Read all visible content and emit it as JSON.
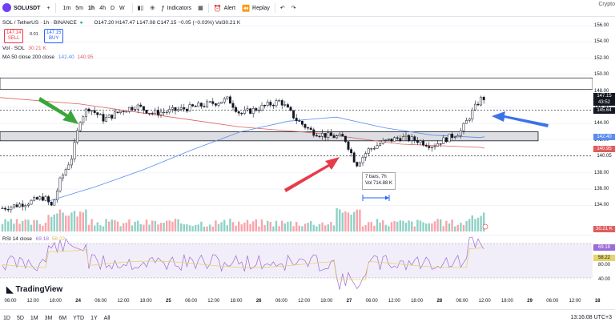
{
  "topbar": {
    "symbol": "SOLUSDT",
    "timeframes": [
      "1m",
      "5m",
      "1h",
      "4h",
      "D",
      "W"
    ],
    "active_timeframe": "1h",
    "indicators_label": "Indicators",
    "alert_label": "Alert",
    "replay_label": "Replay",
    "crypto_label": "Crypto"
  },
  "legend": {
    "title": "SOL / TetherUS · 1h · BINANCE",
    "ohlc": "O147.20 H147.47 L147.08 C147.15 −0.05 (−0.03%) Vol30.21 K",
    "sell_price": "147.14",
    "sell_label": "SELL",
    "spread": "0.01",
    "buy_price": "147.15",
    "buy_label": "BUY",
    "vol_label": "Vol · SOL",
    "vol_value": "30.21 K",
    "ma_label": "MA 50 close 200 close",
    "ma50": "142.40",
    "ma200": "140.95",
    "rsi_label": "RSI 14 close",
    "rsi_value": "69.18",
    "rsi_ma": "58.22"
  },
  "price_axis": {
    "ticks": [
      "156.00",
      "154.00",
      "152.00",
      "150.00",
      "148.00",
      "146.00",
      "144.00",
      "142.00",
      "140.00",
      "138.00",
      "136.00",
      "134.00"
    ],
    "current_price": "147.15",
    "countdown": "43:52",
    "level_1": "145.64",
    "ma50_tag": "142.40",
    "ma200_tag": "140.95",
    "level_2": "140.05",
    "volume_tag": "30.21 K"
  },
  "rsi_axis": {
    "ticks": [
      "80.00",
      "40.00"
    ],
    "rsi_tag": "69.18",
    "rsi_ma_tag": "58.22"
  },
  "time_axis": {
    "ticks": [
      "06:00",
      "12:00",
      "18:00",
      "24",
      "06:00",
      "12:00",
      "18:00",
      "25",
      "06:00",
      "12:00",
      "18:00",
      "26",
      "06:00",
      "12:00",
      "18:00",
      "27",
      "06:00",
      "12:00",
      "18:00",
      "28",
      "06:00",
      "12:00",
      "18:00",
      "29",
      "06:00",
      "12:00",
      "18"
    ]
  },
  "annotation": {
    "bars": "7 bars, 7h",
    "vol": "Vol 714.88 K"
  },
  "bottombar": {
    "ranges": [
      "1D",
      "5D",
      "1M",
      "3M",
      "6M",
      "YTD",
      "1Y",
      "All"
    ],
    "time": "13:16:08 UTC+3"
  },
  "logo_text": "TradingView",
  "colors": {
    "up": "#131722",
    "down": "#131722",
    "ma50": "#5b8def",
    "ma200": "#e05d5d",
    "rsi": "#9c6bd6",
    "rsi_ma": "#e6d36b",
    "arrow_green": "#3aa63a",
    "arrow_red": "#e83b4a",
    "arrow_blue": "#3b73e8"
  }
}
